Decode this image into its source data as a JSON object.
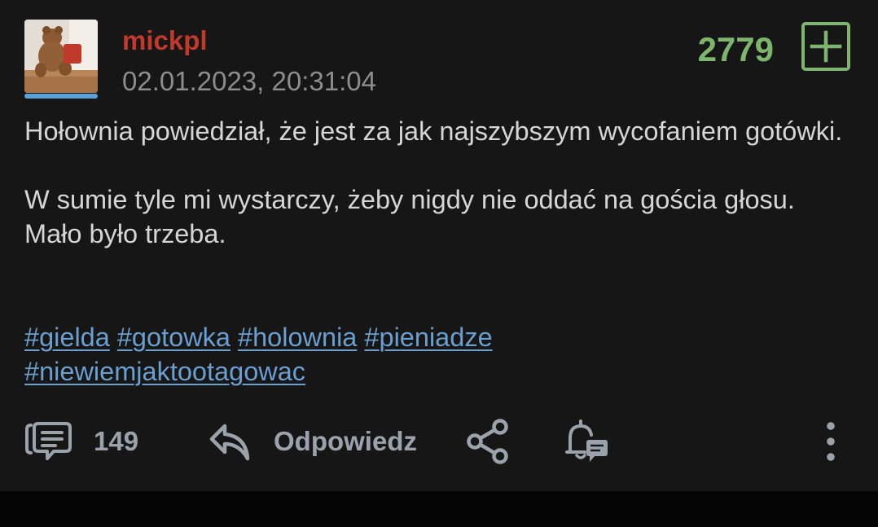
{
  "post": {
    "author": "mickpl",
    "timestamp": "02.01.2023, 20:31:04",
    "votes": "2779",
    "paragraph1": "Hołownia powiedział, że jest za jak najszybszym wycofaniem gotówki.",
    "paragraph2": "W sumie tyle mi wystarczy, żeby nigdy nie oddać na gościa głosu. Mało było trzeba.",
    "tags": [
      "#gielda",
      "#gotowka",
      "#holownia",
      "#pieniadze",
      "#niewiemjaktootagowac"
    ]
  },
  "actions": {
    "comments_count": "149",
    "reply_label": "Odpowiedz"
  },
  "icons": {
    "comments": "comments-icon",
    "reply": "reply-arrow-icon",
    "share": "share-icon",
    "notify": "bell-notification-icon",
    "more": "more-vertical-icon",
    "plus": "plus-icon"
  },
  "colors": {
    "author": "#c0392b",
    "votes": "#7eb56e",
    "tag": "#6a9fd0",
    "icon": "#9aa2ab",
    "avatar_bar": "#5ba0d6"
  }
}
